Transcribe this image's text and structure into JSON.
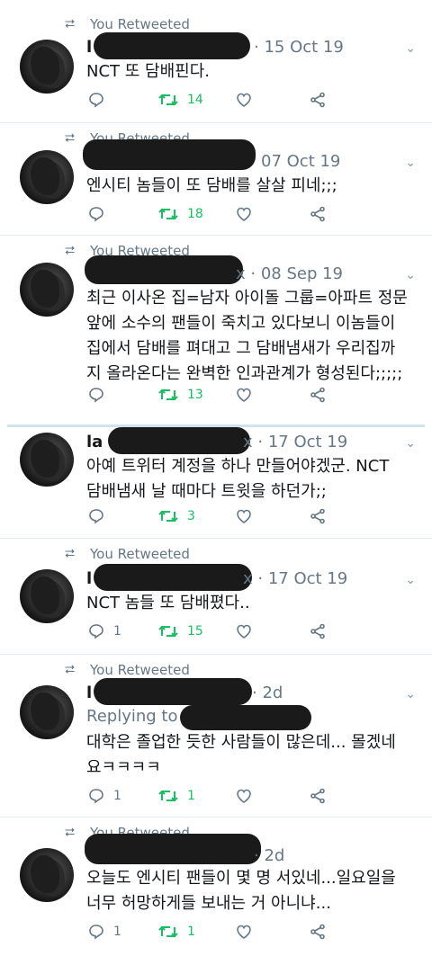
{
  "tweets": [
    {
      "retweeted": "You Retweeted",
      "name": "l",
      "meta": "· 15 Oct 19",
      "text": [
        "NCT 또 담배핀다."
      ],
      "reply_count": "",
      "rt_count": "14",
      "like_count": ""
    },
    {
      "retweeted": "You Retweeted",
      "name": "",
      "meta": "07 Oct 19",
      "text": [
        "엔시티 놈들이 또 담배를 살살 피네;;;"
      ],
      "reply_count": "",
      "rt_count": "18",
      "like_count": ""
    },
    {
      "retweeted": "You Retweeted",
      "name": "",
      "meta": "x · 08 Sep 19",
      "text": [
        "최근 이사온 집=남자 아이돌 그룹=아파트 정문",
        "앞에 소수의 팬들이 죽치고 있다보니 이놈들이",
        "집에서 담배를 펴대고 그 담배냄새가 우리집까",
        "지 올라온다는 완벽한 인과관계가 형성된다;;;;;"
      ],
      "reply_count": "",
      "rt_count": "13",
      "like_count": ""
    },
    {
      "retweeted": "",
      "name": "la",
      "meta": "x · 17 Oct 19",
      "text": [
        "아예 트위터 계정을 하나 만들어야겠군. NCT",
        "담배냄새 날 때마다 트윗을 하던가;;"
      ],
      "reply_count": "",
      "rt_count": "3",
      "like_count": ""
    },
    {
      "retweeted": "You Retweeted",
      "name": "l",
      "meta": "x · 17 Oct 19",
      "text": [
        "NCT 놈들 또 담배폈다.."
      ],
      "reply_count": "1",
      "rt_count": "15",
      "like_count": ""
    },
    {
      "retweeted": "You Retweeted",
      "name": "l",
      "meta": "· 2d",
      "replying": "Replying to",
      "text": [
        "대학은 졸업한 듯한 사람들이 많은데... 몰겠네",
        "요ㅋㅋㅋㅋ"
      ],
      "reply_count": "1",
      "rt_count": "1",
      "like_count": ""
    },
    {
      "retweeted": "You Retweeted",
      "name": "",
      "meta": "· 2d",
      "text": [
        "오늘도 엔시티 팬들이 몇 명 서있네...일요일을",
        "너무 허망하게들 보내는 거 아니냐..."
      ],
      "reply_count": "1",
      "rt_count": "1",
      "like_count": ""
    }
  ],
  "icons": {
    "retweet": "retweet-icon",
    "reply": "reply-icon",
    "like": "heart-icon",
    "share": "share-icon",
    "more": "chevron-down-icon"
  },
  "colors": {
    "retweet_green": "#17bf63",
    "muted": "#657786",
    "redaction": "#1a1a1a"
  }
}
